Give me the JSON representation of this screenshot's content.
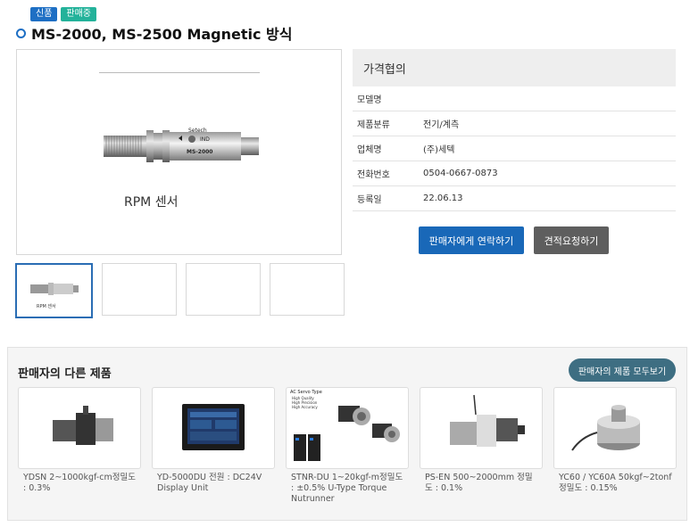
{
  "badges": {
    "new": "신품",
    "selling": "판매중"
  },
  "product": {
    "title": "MS-2000, MS-2500 Magnetic 방식",
    "image_caption": "RPM 센서",
    "thumb_caption": "RPM 센서",
    "sensor_brand": "Setech",
    "sensor_label": "IND",
    "sensor_model": "MS-2000"
  },
  "info": {
    "price": "가격협의",
    "rows": [
      {
        "label": "모델명",
        "value": ""
      },
      {
        "label": "제품분류",
        "value": "전기/계측"
      },
      {
        "label": "업체명",
        "value": "(주)세텍"
      },
      {
        "label": "전화번호",
        "value": "0504-0667-0873"
      },
      {
        "label": "등록일",
        "value": "22.06.13"
      }
    ]
  },
  "buttons": {
    "contact": "판매자에게 연락하기",
    "quote": "견적요청하기"
  },
  "other": {
    "title": "판매자의 다른 제품",
    "see_all": "판매자의 제품 모두보기",
    "items": [
      {
        "name": "YDSN 2~1000kgf-cm정밀도 : 0.3%"
      },
      {
        "name": "YD-5000DU 전원 : DC24V Display Unit"
      },
      {
        "name": "STNR-DU 1~20kgf-m정밀도 : ±0.5% U-Type Torque Nutrunner",
        "image_title": "AC Servo Type",
        "image_bullets": [
          "High Quality",
          "High Precision",
          "High Accuracy"
        ]
      },
      {
        "name": "PS-EN 500~2000mm 정밀도 : 0.1%"
      },
      {
        "name": "YC60 / YC60A 50kgf~2tonf 정밀도 : 0.15%"
      }
    ]
  },
  "colors": {
    "accent": "#1968b8",
    "badge_blue": "#1e6fc4",
    "badge_green": "#23b29a",
    "secondary_button": "#5e5e5e",
    "see_all_button": "#3e6e82"
  }
}
